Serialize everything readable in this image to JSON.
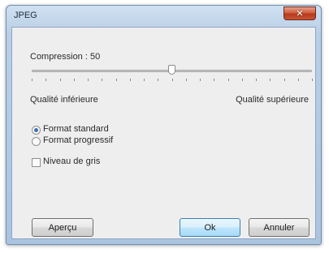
{
  "window": {
    "title": "JPEG",
    "close_glyph": "✕"
  },
  "compression": {
    "label": "Compression : 50",
    "value": 50,
    "min": 0,
    "max": 100,
    "tick_count": 21,
    "low_label": "Qualité inférieure",
    "high_label": "Qualité supérieure"
  },
  "format": {
    "standard_label": "Format standard",
    "progressive_label": "Format progressif",
    "selected": "standard"
  },
  "grayscale": {
    "label": "Niveau de gris",
    "checked": false
  },
  "buttons": {
    "preview_label": "Aperçu",
    "ok_label": "Ok",
    "cancel_label": "Annuler"
  },
  "icons": {
    "close": "close-icon",
    "radio": "radio-button",
    "checkbox": "checkbox"
  }
}
